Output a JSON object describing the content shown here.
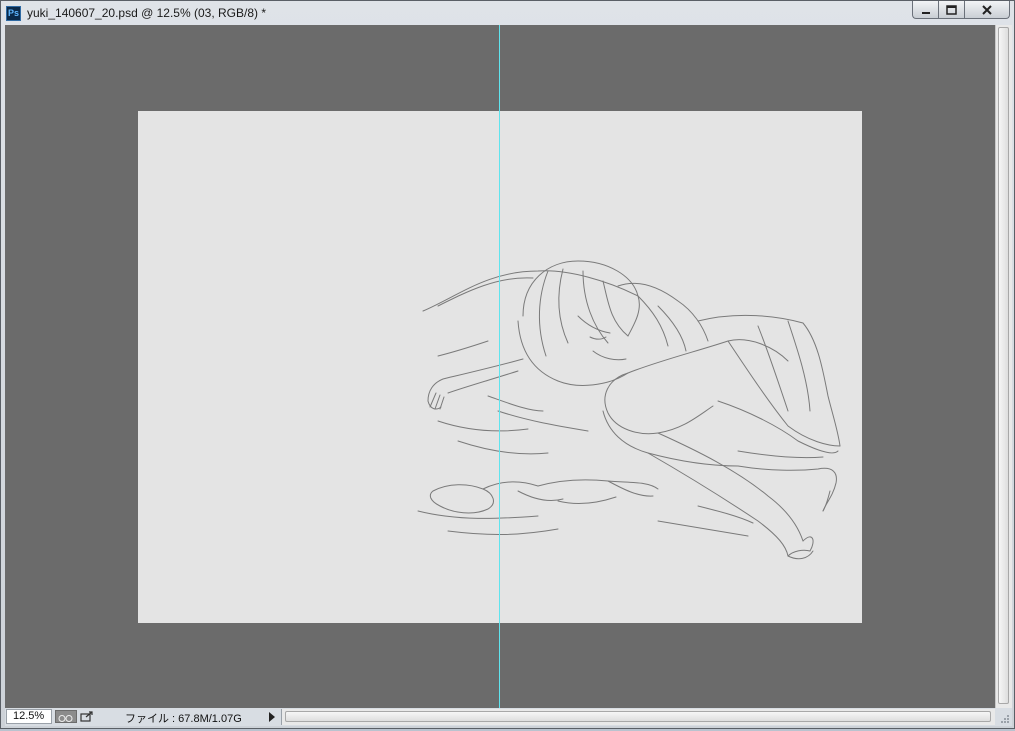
{
  "window": {
    "title": "yuki_140607_20.psd @ 12.5% (03, RGB/8) *",
    "app_icon_label": "Ps",
    "controls": {
      "minimize_icon": "minimize-icon",
      "maximize_icon": "maximize-icon",
      "close_icon": "close-icon"
    }
  },
  "canvas": {
    "background_color": "#e4e4e4",
    "pasteboard_color": "#6b6b6b",
    "guide_color": "#5fe4ee",
    "artwork": "line-sketch"
  },
  "statusbar": {
    "zoom": "12.5%",
    "info": "ファイル : 67.8M/1.07G",
    "proof_icon": "proof-setup-icon",
    "share_icon": "share-icon",
    "menu_icon": "triangle-right-icon"
  }
}
